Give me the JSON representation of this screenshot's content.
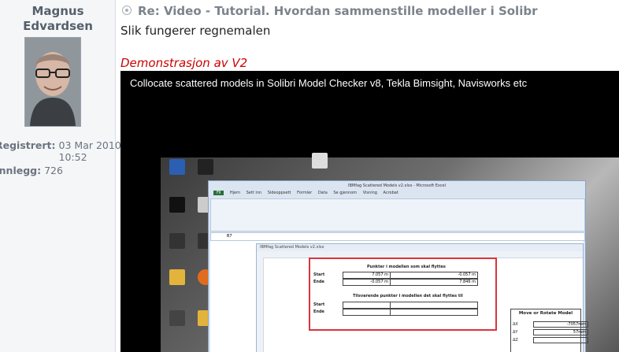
{
  "author": {
    "first_name": "Magnus",
    "last_name": "Edvardsen",
    "registered_label": "Registrert:",
    "registered_value": "03 Mar 2010, 10:52",
    "posts_label": "Innlegg:",
    "posts_value": "726"
  },
  "post": {
    "title": "Re: Video - Tutorial. Hvordan sammenstille modeller i Solibr",
    "body": "Slik fungerer regnemalen",
    "demo_heading": "Demonstrasjon av V2"
  },
  "video": {
    "title": "Collocate scattered models in Solibri Model Checker v8, Tekla Bimsight, Navisworks etc",
    "excel_title": "IBMfag Scattered Models v2.xlsx - Microsoft Excel",
    "tabs": [
      "Fil",
      "Hjem",
      "Sett inn",
      "Sideoppsett",
      "Formler",
      "Data",
      "Se gjennom",
      "Visning",
      "Acrobat"
    ],
    "cell_ref": "B7",
    "sheet_title": "IBMfag Scattered Models v2.xlsx",
    "table1_heading": "Punkter i modellen som skal flyttes",
    "table2_heading": "Tilsvarende punkter i modellen det skal flyttes til",
    "start_label": "Start",
    "end_label": "Ende",
    "table1": [
      [
        "7.057 m",
        "-0.057 m"
      ],
      [
        "-0.057 m",
        "7.846 m"
      ]
    ],
    "mr_title": "Move or Rotate  Model",
    "mr_rows": [
      {
        "label": "ΔX",
        "value": "-7057mm"
      },
      {
        "label": "ΔY",
        "value": "57mm"
      },
      {
        "label": "ΔZ",
        "value": ""
      }
    ]
  }
}
